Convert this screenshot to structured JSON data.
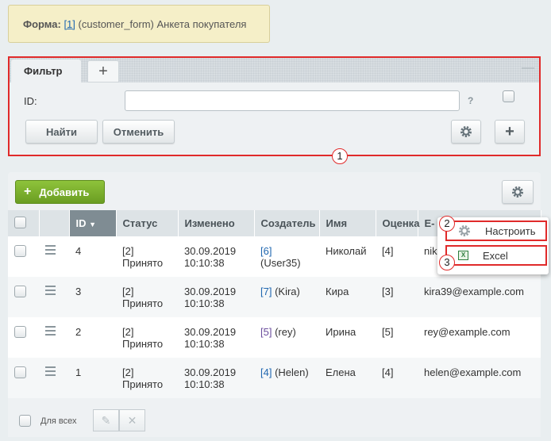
{
  "form_header": {
    "prefix": "Форма:",
    "link": "[1]",
    "text": "(customer_form) Анкета покупателя"
  },
  "filter": {
    "tab_label": "Фильтр",
    "add_tab": "+",
    "minimize": "—",
    "id_label": "ID:",
    "id_value": "",
    "help": "?",
    "find_button": "Найти",
    "cancel_button": "Отменить",
    "plus_button": "+"
  },
  "callouts": [
    "1",
    "2",
    "3"
  ],
  "toolbar": {
    "add_button": "Добавить",
    "add_plus": "+"
  },
  "table": {
    "columns": [
      "ID",
      "Статус",
      "Изменено",
      "Создатель",
      "Имя",
      "Оценка",
      "E-"
    ],
    "sort_arrow": "▼",
    "rows": [
      {
        "id": "4",
        "status_code": "[2]",
        "status": "Принято",
        "date": "30.09.2019",
        "time": "10:10:38",
        "creator_id": "[6]",
        "creator": "(User35)",
        "name": "Николай",
        "rating": "[4]",
        "email": "niko"
      },
      {
        "id": "3",
        "status_code": "[2]",
        "status": "Принято",
        "date": "30.09.2019",
        "time": "10:10:38",
        "creator_id": "[7]",
        "creator": "(Kira)",
        "name": "Кира",
        "rating": "[3]",
        "email": "kira39@example.com"
      },
      {
        "id": "2",
        "status_code": "[2]",
        "status": "Принято",
        "date": "30.09.2019",
        "time": "10:10:38",
        "creator_id": "[5]",
        "creator": "(rey)",
        "name": "Ирина",
        "rating": "[5]",
        "email": "rey@example.com"
      },
      {
        "id": "1",
        "status_code": "[2]",
        "status": "Принято",
        "date": "30.09.2019",
        "time": "10:10:38",
        "creator_id": "[4]",
        "creator": "(Helen)",
        "name": "Елена",
        "rating": "[4]",
        "email": "helen@example.com"
      }
    ]
  },
  "footer": {
    "all_label": "Для всех",
    "edit_icon": "✎",
    "delete_icon": "✕"
  },
  "popup_menu": {
    "items": [
      {
        "label": "Настроить",
        "icon": "gear-icon"
      },
      {
        "label": "Excel",
        "icon": "excel-icon"
      }
    ]
  },
  "colors": {
    "accent_green": "#7ab02e",
    "highlight_red": "#e02a2a",
    "link_blue": "#2067b0"
  }
}
